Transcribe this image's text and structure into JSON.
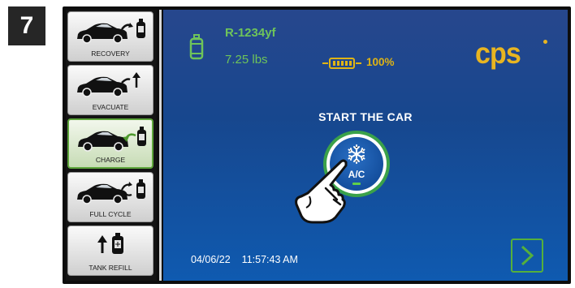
{
  "step_number": "7",
  "sidebar": {
    "items": [
      {
        "label": "RECOVERY",
        "icon": "car-recovery-icon",
        "active": false
      },
      {
        "label": "EVACUATE",
        "icon": "car-evacuate-icon",
        "active": false
      },
      {
        "label": "CHARGE",
        "icon": "car-charge-icon",
        "active": true
      },
      {
        "label": "FULL CYCLE",
        "icon": "car-full-cycle-icon",
        "active": false
      },
      {
        "label": "TANK REFILL",
        "icon": "tank-refill-icon",
        "active": false
      }
    ]
  },
  "status": {
    "refrigerant": "R-1234yf",
    "weight": "7.25 lbs",
    "battery_percent": "100%"
  },
  "brand": {
    "logo": "cps"
  },
  "main": {
    "prompt": "START THE CAR",
    "ac_label": "A/C"
  },
  "footer": {
    "date": "04/06/22",
    "time": "11:57:43 AM"
  },
  "colors": {
    "accent_green": "#6ec45a",
    "battery_yellow": "#e0b414",
    "brand_yellow": "#e8b521",
    "screen_blue": "#17478e"
  },
  "icons": {
    "tank": "refrigerant-tank-icon",
    "battery": "battery-icon",
    "ac": "snowflake-icon",
    "hand": "pointing-hand-icon",
    "next": "chevron-right-icon"
  }
}
